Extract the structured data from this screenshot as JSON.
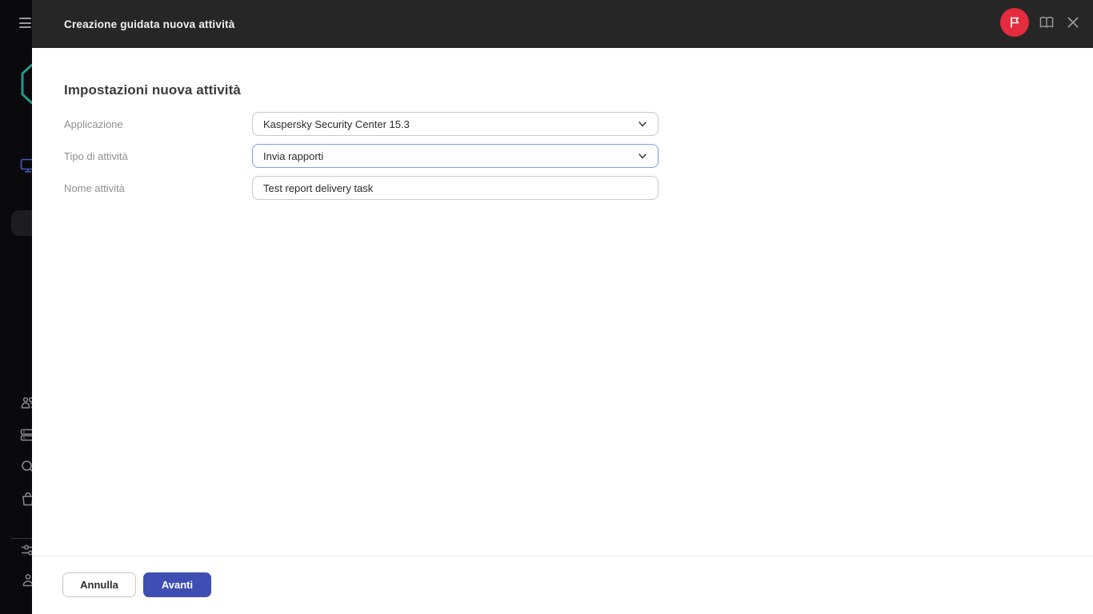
{
  "topbar": {
    "title": "Creazione guidata nuova attività",
    "icons": {
      "whats_new": "flag-icon",
      "help": "book-icon",
      "close": "close-icon"
    }
  },
  "sidebar": {
    "icons": [
      "menu-icon",
      "kaspersky-logo",
      "devices-monitor-icon",
      "users-icon",
      "servers-icon",
      "search-icon",
      "marketplace-bag-icon",
      "settings-sliders-icon",
      "account-person-icon"
    ]
  },
  "wizard": {
    "heading": "Impostazioni nuova attività",
    "fields": [
      {
        "label": "Applicazione",
        "value": "Kaspersky Security Center 15.3",
        "type": "select",
        "focused": false
      },
      {
        "label": "Tipo di attività",
        "value": "Invia rapporti",
        "type": "select",
        "focused": true
      },
      {
        "label": "Nome attività",
        "value": "Test report delivery task",
        "type": "text",
        "focused": false
      }
    ],
    "footer": {
      "cancel_label": "Annulla",
      "next_label": "Avanti"
    }
  },
  "colors": {
    "topbar_bg": "#262626",
    "primary_button": "#3f4eb3",
    "focus_border": "#7b9df1",
    "flag_badge": "#e52b3e",
    "logo_teal": "#23998a",
    "monitor_blue": "#4656c0"
  }
}
